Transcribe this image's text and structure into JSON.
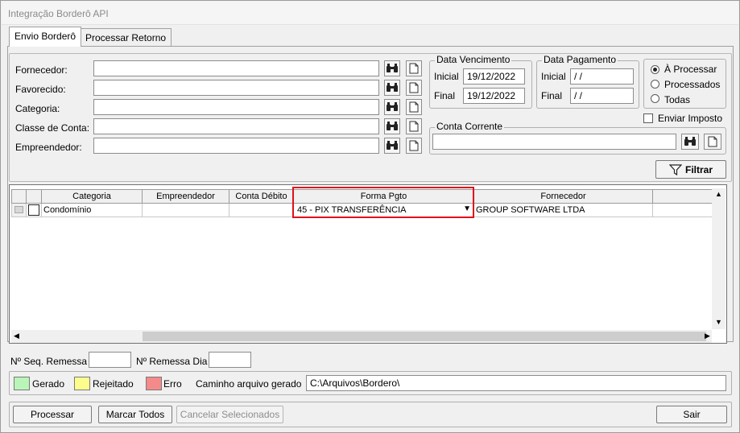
{
  "window": {
    "title": "Integração Borderô API"
  },
  "tabs": [
    {
      "label": "Envio Borderô",
      "active": true
    },
    {
      "label": "Processar Retorno",
      "active": false
    }
  ],
  "filters": {
    "fornecedor": {
      "label": "Fornecedor:",
      "value": ""
    },
    "favorecido": {
      "label": "Favorecido:",
      "value": ""
    },
    "categoria": {
      "label": "Categoria:",
      "value": ""
    },
    "classe_conta": {
      "label": "Classe de Conta:",
      "value": ""
    },
    "empreendedor": {
      "label": "Empreendedor:",
      "value": ""
    }
  },
  "data_vencimento": {
    "title": "Data Vencimento",
    "inicial_label": "Inicial",
    "inicial_value": "19/12/2022",
    "final_label": "Final",
    "final_value": "19/12/2022"
  },
  "data_pagamento": {
    "title": "Data Pagamento",
    "inicial_label": "Inicial",
    "inicial_value": " / /",
    "final_label": "Final",
    "final_value": " / /"
  },
  "status_options": [
    {
      "label": "À Processar",
      "selected": true
    },
    {
      "label": "Processados",
      "selected": false
    },
    {
      "label": "Todas",
      "selected": false
    }
  ],
  "enviar_imposto": {
    "label": "Enviar Imposto",
    "checked": false
  },
  "conta_corrente": {
    "title": "Conta Corrente",
    "value": ""
  },
  "filtrar_button": {
    "label": "Filtrar"
  },
  "grid": {
    "columns": [
      "Categoria",
      "Empreendedor",
      "Conta Débito",
      "Forma Pgto",
      "Fornecedor"
    ],
    "rows": [
      {
        "categoria": "Condomínio",
        "empreendedor": "",
        "conta_debito": "",
        "forma_pgto": "45 - PIX TRANSFERÊNCIA",
        "fornecedor": "GROUP SOFTWARE LTDA"
      }
    ]
  },
  "remessa": {
    "seq_label": "Nº Seq. Remessa",
    "seq_value": "",
    "dia_label": "Nº Remessa Dia",
    "dia_value": ""
  },
  "legend": {
    "items": [
      {
        "label": "Gerado",
        "color": "#b9f5b9"
      },
      {
        "label": "Rejeitado",
        "color": "#fdfd8e"
      },
      {
        "label": "Erro",
        "color": "#f58a8a"
      }
    ],
    "caminho_label": "Caminho arquivo gerado",
    "caminho_value": "C:\\Arquivos\\Bordero\\"
  },
  "actions": {
    "processar": "Processar",
    "marcar_todos": "Marcar Todos",
    "cancelar_selecionados": "Cancelar Selecionados",
    "sair": "Sair"
  },
  "colors": {
    "highlight": "#e0101a",
    "window_bg": "#f0f0f0"
  }
}
